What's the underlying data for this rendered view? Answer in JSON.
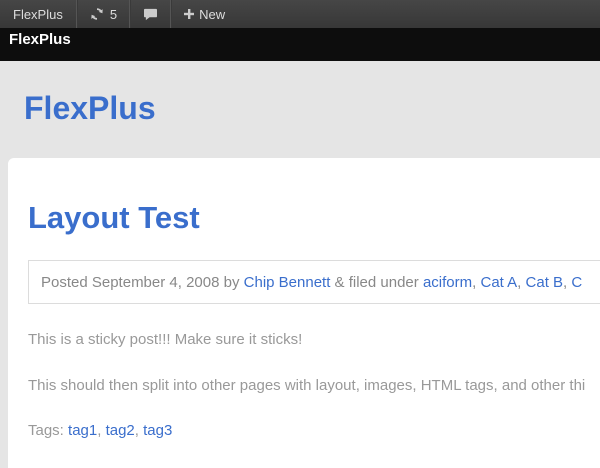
{
  "adminbar": {
    "site_name": "FlexPlus",
    "updates_count": "5",
    "new_label": "New"
  },
  "header": {
    "strip_title": "FlexPlus",
    "site_title": "FlexPlus"
  },
  "post": {
    "title": "Layout Test",
    "meta": {
      "posted_prefix": "Posted September 4, 2008 by",
      "author": "Chip Bennett",
      "filed_text": "& filed under",
      "categories": [
        "aciform",
        "Cat A",
        "Cat B",
        "C"
      ]
    },
    "paragraphs": [
      "This is a sticky post!!! Make sure it sticks!",
      "This should then split into other pages with layout, images, HTML tags, and other thi"
    ],
    "tags_label": "Tags:",
    "tags": [
      "tag1",
      "tag2",
      "tag3"
    ]
  },
  "colors": {
    "link": "#3a6ecc",
    "adminbar_bg": "#464646",
    "header_strip_bg": "#0d0d0d",
    "page_bg": "#e5e5e5"
  }
}
